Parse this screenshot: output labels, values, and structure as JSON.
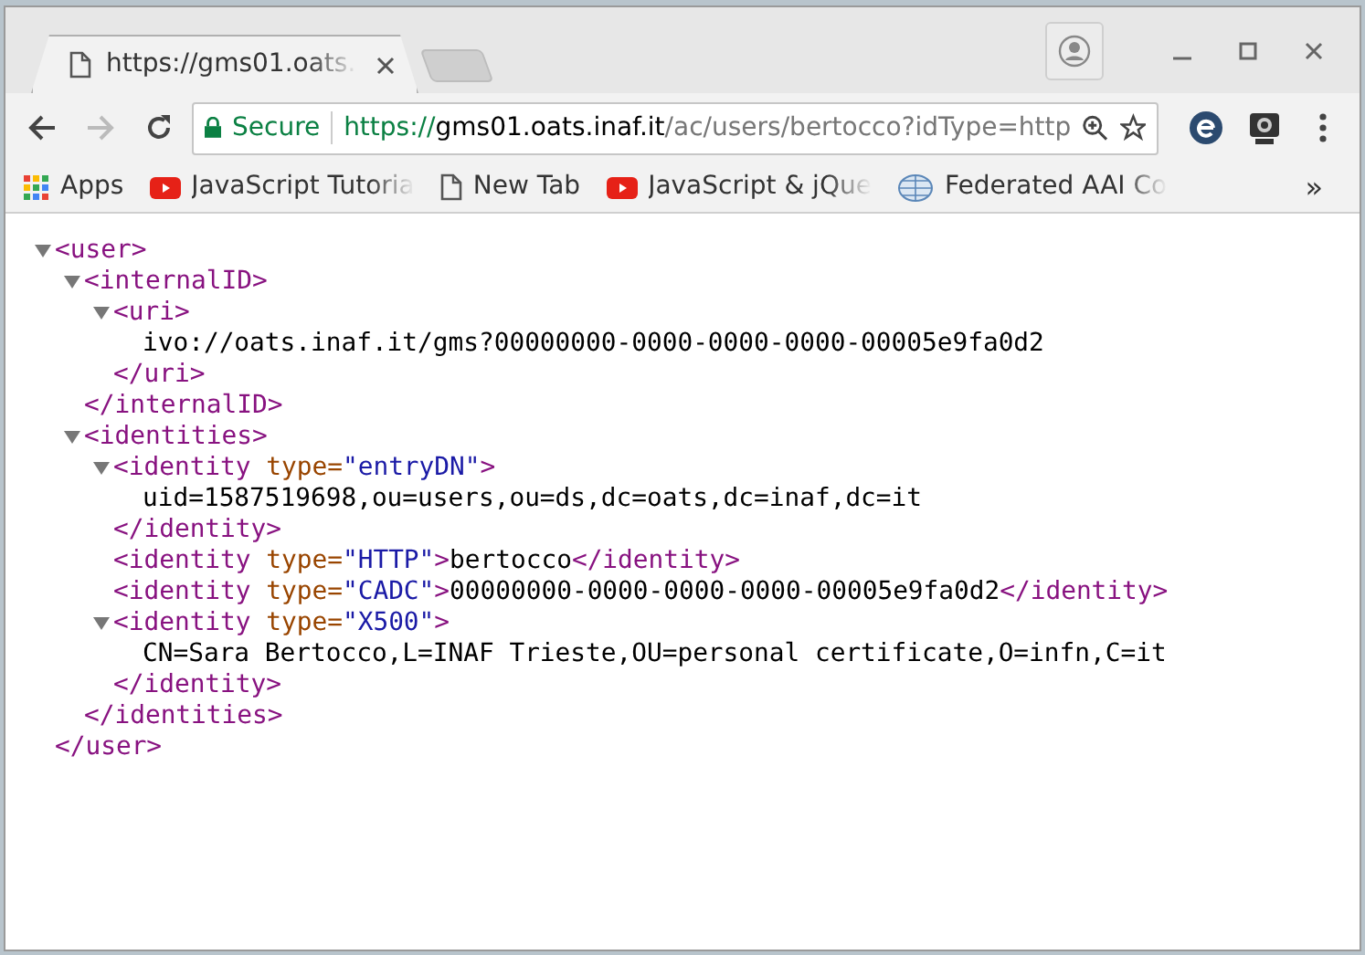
{
  "tabs": [
    {
      "title": "https://gms01.oats.i",
      "selected": true
    }
  ],
  "toolbar": {
    "back_enabled": true,
    "forward_enabled": false,
    "security_label": "Secure",
    "url": {
      "scheme": "https://",
      "host": "gms01.oats.inaf.it",
      "path": "/ac/users/bertocco?idType=http"
    }
  },
  "bookmarks": [
    {
      "kind": "apps",
      "label": "Apps"
    },
    {
      "kind": "video",
      "label": "JavaScript Tutoria"
    },
    {
      "kind": "page",
      "label": "New Tab"
    },
    {
      "kind": "video",
      "label": "JavaScript & jQue"
    },
    {
      "kind": "logo",
      "label": "Federated AAI Co"
    }
  ],
  "bookmarks_overflow": "»",
  "xml_tree": {
    "kind": "element",
    "open": "<user>",
    "close": "</user>",
    "expanded": true,
    "children": [
      {
        "kind": "element",
        "open": "<internalID>",
        "close": "</internalID>",
        "expanded": true,
        "children": [
          {
            "kind": "element",
            "open": "<uri>",
            "close": "</uri>",
            "expanded": true,
            "children": [
              {
                "kind": "text",
                "text": "ivo://oats.inaf.it/gms?00000000-0000-0000-0000-00005e9fa0d2"
              }
            ]
          }
        ]
      },
      {
        "kind": "element",
        "open": "<identities>",
        "close": "</identities>",
        "expanded": true,
        "children": [
          {
            "kind": "element",
            "open": "<identity type=\"entryDN\">",
            "close": "</identity>",
            "expanded": true,
            "children": [
              {
                "kind": "text",
                "text": "uid=1587519698,ou=users,ou=ds,dc=oats,dc=inaf,dc=it"
              }
            ]
          },
          {
            "kind": "leaf",
            "open": "<identity type=\"HTTP\">",
            "text": "bertocco",
            "close": "</identity>"
          },
          {
            "kind": "leaf",
            "open": "<identity type=\"CADC\">",
            "text": "00000000-0000-0000-0000-00005e9fa0d2",
            "close": "</identity>"
          },
          {
            "kind": "element",
            "open": "<identity type=\"X500\">",
            "close": "</identity>",
            "expanded": true,
            "children": [
              {
                "kind": "text",
                "text": "CN=Sara Bertocco,L=INAF Trieste,OU=personal certificate,O=infn,C=it"
              }
            ]
          }
        ]
      }
    ]
  }
}
